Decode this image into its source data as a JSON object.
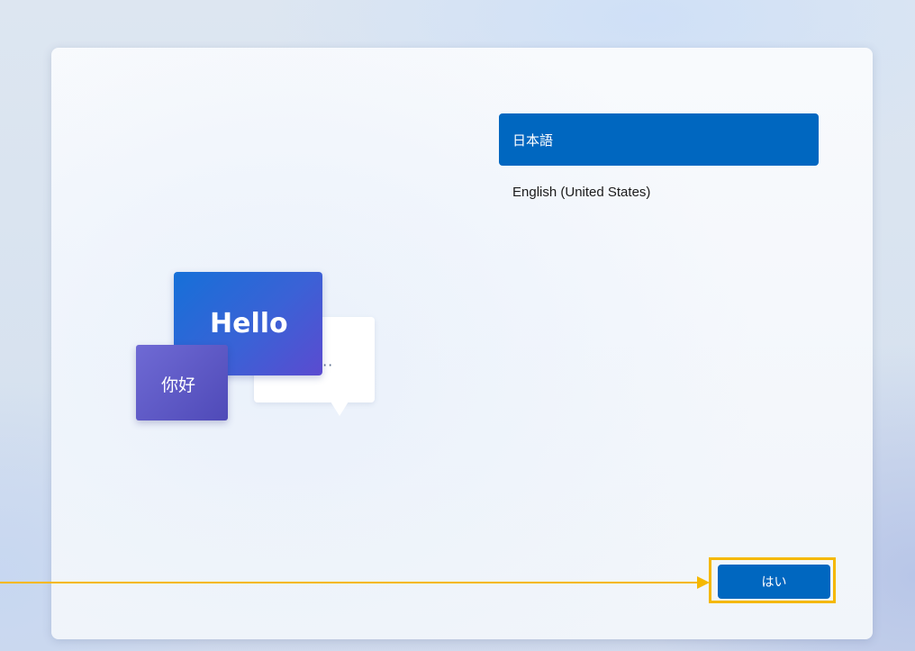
{
  "illustration": {
    "hello_text": "Hello",
    "nihao_text": "你好",
    "typing_indicator": "···"
  },
  "languages": {
    "items": [
      {
        "label": "日本語",
        "selected": true
      },
      {
        "label": "English (United States)",
        "selected": false
      }
    ]
  },
  "actions": {
    "yes_label": "はい"
  },
  "annotation": {
    "highlight_color": "#f5b800"
  },
  "colors": {
    "accent": "#0067c0",
    "card_background": "#f6f8fc"
  }
}
